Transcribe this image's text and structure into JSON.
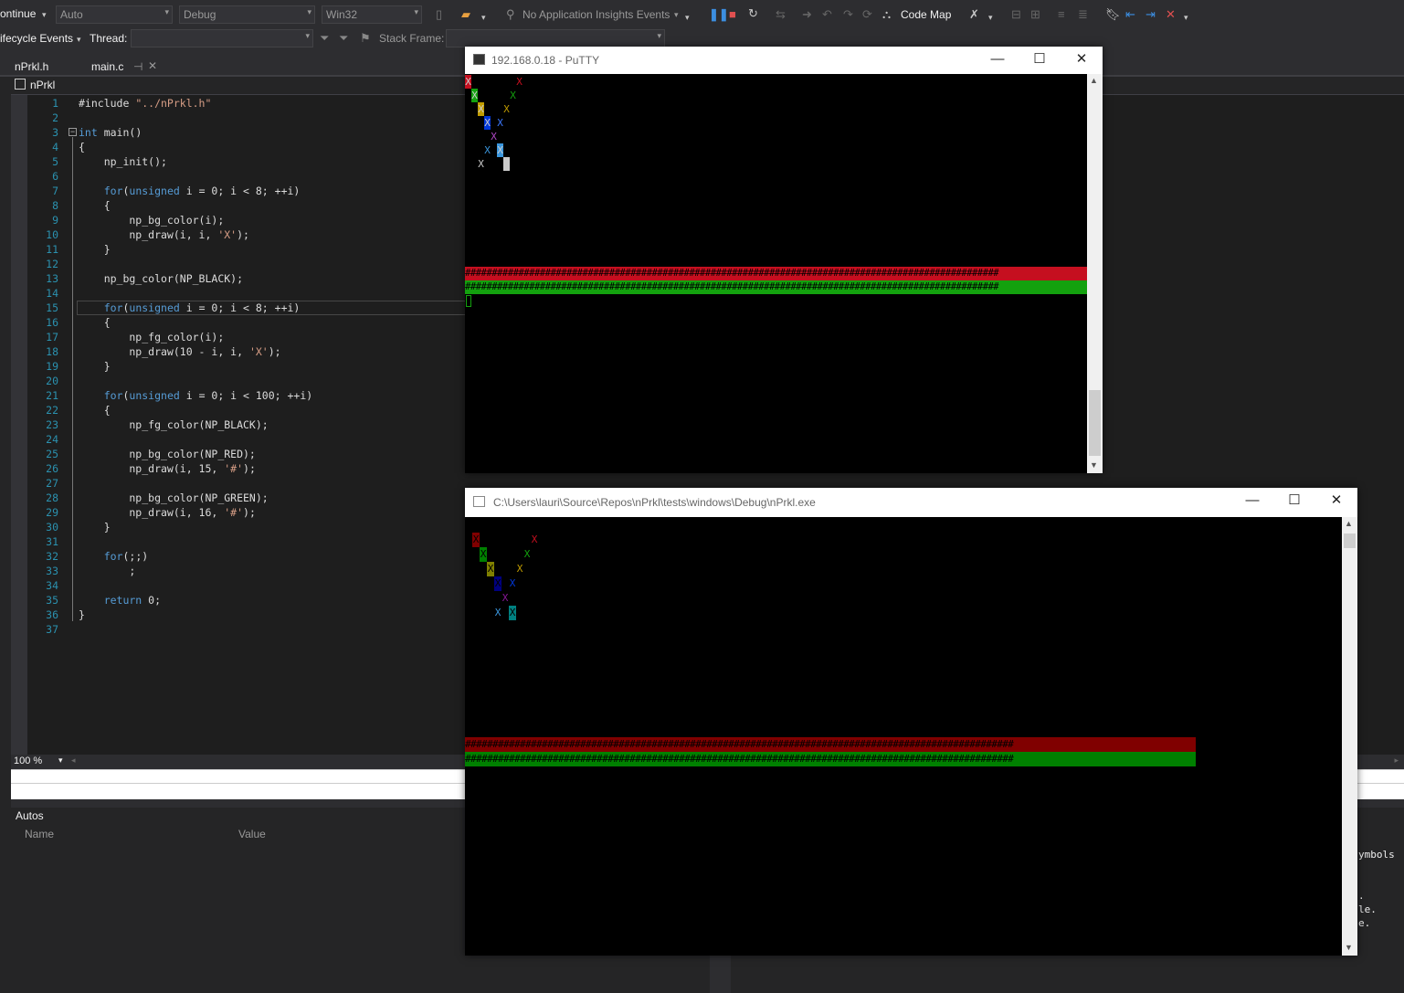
{
  "toolbar": {
    "continue_label": "ontinue",
    "combo_auto": "Auto",
    "combo_debug": "Debug",
    "combo_platform": "Win32",
    "insights_label": "No Application Insights Events",
    "codemap_label": "Code Map",
    "lifecycle_label": "ifecycle Events",
    "thread_label": "Thread:",
    "thread_value": "",
    "stackframe_label": "Stack Frame:",
    "stackframe_value": ""
  },
  "tabs": [
    {
      "label": "nPrkl.h"
    },
    {
      "label": "main.c"
    }
  ],
  "navbar": {
    "project": "nPrkl"
  },
  "code_lines": [
    {
      "n": "1"
    },
    {
      "n": "2"
    },
    {
      "n": "3"
    },
    {
      "n": "4"
    },
    {
      "n": "5"
    },
    {
      "n": "6"
    },
    {
      "n": "7"
    },
    {
      "n": "8"
    },
    {
      "n": "9"
    },
    {
      "n": "10"
    },
    {
      "n": "11"
    },
    {
      "n": "12"
    },
    {
      "n": "13"
    },
    {
      "n": "14"
    },
    {
      "n": "15"
    },
    {
      "n": "16"
    },
    {
      "n": "17"
    },
    {
      "n": "18"
    },
    {
      "n": "19"
    },
    {
      "n": "20"
    },
    {
      "n": "21"
    },
    {
      "n": "22"
    },
    {
      "n": "23"
    },
    {
      "n": "24"
    },
    {
      "n": "25"
    },
    {
      "n": "26"
    },
    {
      "n": "27"
    },
    {
      "n": "28"
    },
    {
      "n": "29"
    },
    {
      "n": "30"
    },
    {
      "n": "31"
    },
    {
      "n": "32"
    },
    {
      "n": "33"
    },
    {
      "n": "34"
    },
    {
      "n": "35"
    },
    {
      "n": "36"
    },
    {
      "n": "37"
    }
  ],
  "code": {
    "l1a": "#include ",
    "l1b": "\"../nPrkl.h\"",
    "l3a": "int",
    "l3b": " main()",
    "l4": "{",
    "l5": "    np_init();",
    "l7a": "    for",
    "l7b": "(",
    "l7c": "unsigned",
    "l7d": " i = 0; i < 8; ++i)",
    "l8": "    {",
    "l9": "        np_bg_color(i);",
    "l10a": "        np_draw(i, i, ",
    "l10b": "'X'",
    "l10c": ");",
    "l11": "    }",
    "l13": "    np_bg_color(NP_BLACK);",
    "l15a": "    for",
    "l15b": "(",
    "l15c": "unsigned",
    "l15d": " i = 0; i < 8; ++i)",
    "l16": "    {",
    "l17": "        np_fg_color(i);",
    "l18a": "        np_draw(10 - i, i, ",
    "l18b": "'X'",
    "l18c": ");",
    "l19": "    }",
    "l21a": "    for",
    "l21b": "(",
    "l21c": "unsigned",
    "l21d": " i = 0; i < 100; ++i)",
    "l22": "    {",
    "l23": "        np_fg_color(NP_BLACK);",
    "l25": "        np_bg_color(NP_RED);",
    "l26a": "        np_draw(i, 15, ",
    "l26b": "'#'",
    "l26c": ");",
    "l28": "        np_bg_color(NP_GREEN);",
    "l29a": "        np_draw(i, 16, ",
    "l29b": "'#'",
    "l29c": ");",
    "l30": "    }",
    "l32a": "    for",
    "l32b": "(;;)",
    "l33": "        ;",
    "l35a": "    return",
    "l35b": " 0;",
    "l36": "}"
  },
  "zoom": {
    "value": "100 %"
  },
  "autos": {
    "title": "Autos",
    "col_name": "Name",
    "col_value": "Value"
  },
  "right_panel": {
    "line1": "ymbols",
    "line2": ".",
    "line3": "le.",
    "line4": "e."
  },
  "putty": {
    "title": "192.168.0.18 - PuTTY",
    "x_char": "X",
    "hash_row": "####################################################################################################"
  },
  "console": {
    "title": "C:\\Users\\lauri\\Source\\Repos\\nPrkl\\tests\\windows\\Debug\\nPrkl.exe",
    "x_char": "X",
    "hash_row": "####################################################################################################"
  },
  "colors": {
    "black": "#000000",
    "red": "#c50f1f",
    "green": "#13a10e",
    "yellow": "#c19c00",
    "blue": "#0037da",
    "magenta": "#881798",
    "cyan": "#3a96dd",
    "white": "#cccccc"
  }
}
